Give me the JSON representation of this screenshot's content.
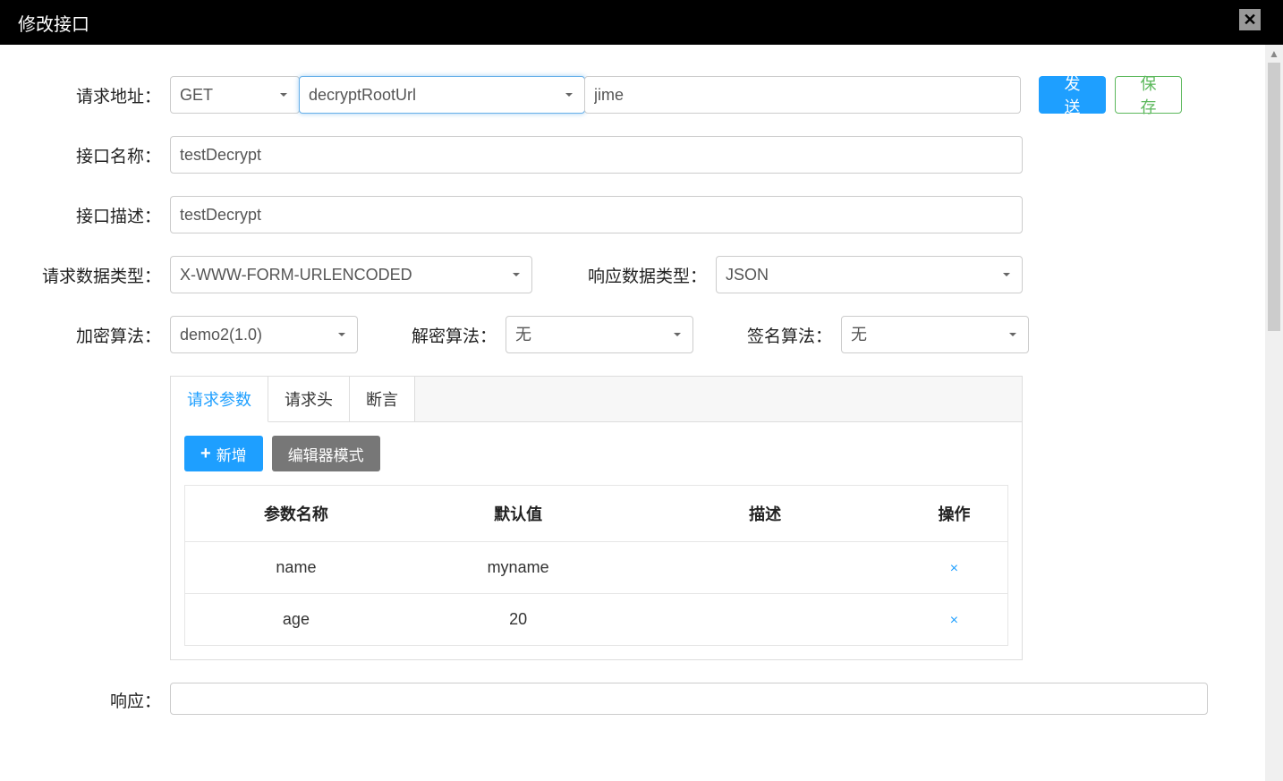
{
  "header": {
    "title": "修改接口"
  },
  "form": {
    "request_address_label": "请求地址：",
    "method": "GET",
    "root_url": "decryptRootUrl",
    "path": "jime",
    "send_button": "发送",
    "save_button": "保存",
    "api_name_label": "接口名称：",
    "api_name_value": "testDecrypt",
    "api_desc_label": "接口描述：",
    "api_desc_value": "testDecrypt",
    "request_type_label": "请求数据类型：",
    "request_type_value": "X-WWW-FORM-URLENCODED",
    "response_type_label": "响应数据类型：",
    "response_type_value": "JSON",
    "encrypt_algo_label": "加密算法：",
    "encrypt_algo_value": "demo2(1.0)",
    "decrypt_algo_label": "解密算法：",
    "decrypt_algo_value": "无",
    "sign_algo_label": "签名算法：",
    "sign_algo_value": "无"
  },
  "tabs": {
    "tab1": "请求参数",
    "tab2": "请求头",
    "tab3": "断言"
  },
  "param_buttons": {
    "add": "新增",
    "editor_mode": "编辑器模式"
  },
  "table": {
    "headers": {
      "name": "参数名称",
      "default": "默认值",
      "desc": "描述",
      "action": "操作"
    },
    "rows": [
      {
        "name": "name",
        "default": "myname",
        "desc": ""
      },
      {
        "name": "age",
        "default": "20",
        "desc": ""
      }
    ]
  },
  "response_label": "响应："
}
